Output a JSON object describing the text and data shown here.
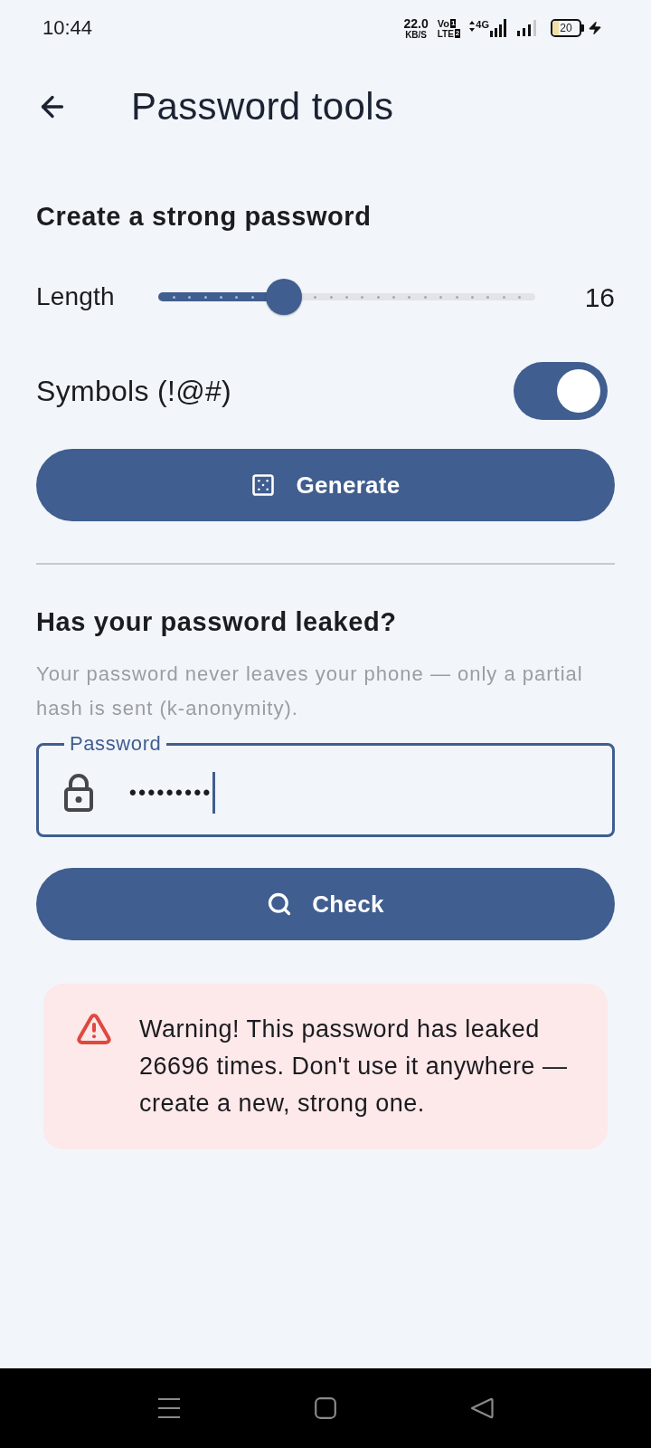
{
  "status_bar": {
    "time": "10:44",
    "net_speed": "22.0",
    "net_speed_unit": "KB/S",
    "volte_top": "Vo",
    "volte_top_badge": "1",
    "volte_bottom": "LTE",
    "volte_bottom_badge": "2",
    "network_type": "4G",
    "battery": "20"
  },
  "app_bar": {
    "title": "Password tools"
  },
  "generator": {
    "heading": "Create a strong password",
    "length": {
      "label": "Length",
      "level": 0.333,
      "value": "16"
    },
    "symbols": {
      "label": "Symbols (!@#)",
      "on": true
    },
    "generate_button": "Generate"
  },
  "leak_check": {
    "heading": "Has your password leaked?",
    "description": "Your password never leaves your phone — only a partial hash is sent (k-anonymity).",
    "password_field": {
      "label": "Password",
      "value": "•••••••••",
      "focused": true
    },
    "check_button": "Check",
    "result": {
      "kind": "warning",
      "text": "Warning! This password has leaked 26696 times. Don't use it anywhere — create a new, strong one."
    }
  }
}
